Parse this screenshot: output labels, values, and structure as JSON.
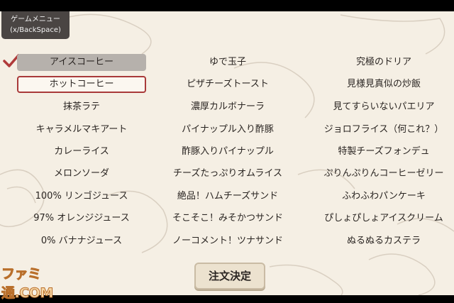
{
  "menu_badge": {
    "title": "ゲームメニュー",
    "hint": "(x/BackSpace)"
  },
  "columns": [
    [
      "アイスコーヒー",
      "ホットコーヒー",
      "抹茶ラテ",
      "キャラメルマキアート",
      "カレーライス",
      "メロンソーダ",
      "100% リンゴジュース",
      "97% オレンジジュース",
      "0% バナナジュース"
    ],
    [
      "ゆで玉子",
      "ピザチーズトースト",
      "濃厚カルボナーラ",
      "パイナップル入り酢豚",
      "酢豚入りパイナップル",
      "チーズたっぷりオムライス",
      "絶品！ハムチーズサンド",
      "そこそこ！みそかつサンド",
      "ノーコメント！ツナサンド"
    ],
    [
      "究極のドリア",
      "見様見真似の炒飯",
      "見てすらいないパエリア",
      "ジョロフライス（何これ？）",
      "特製チーズフォンデュ",
      "ぷりんぷりんコーヒーゼリー",
      "ふわふわパンケーキ",
      "ぴしょぴしょアイスクリーム",
      "ぬるぬるカステラ"
    ]
  ],
  "selected_item": "アイスコーヒー",
  "focused_item": "ホットコーヒー",
  "order_button": "注文決定",
  "watermark": "ファミ通.COM",
  "colors": {
    "check": "#b03a3a",
    "focus_border": "#a93a3a",
    "background": "#f5efe4"
  }
}
